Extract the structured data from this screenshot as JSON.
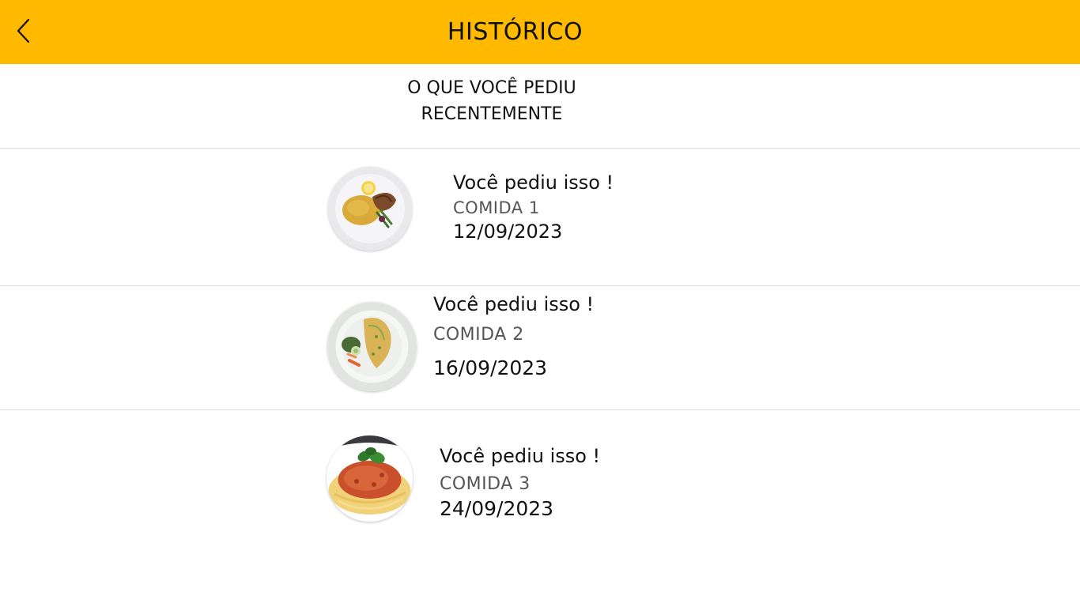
{
  "header": {
    "title": "HISTÓRICO",
    "back_icon": "chevron-left-icon",
    "background_color": "#FFBA00"
  },
  "subtitle": {
    "line1": "O QUE VOCÊ PEDIU",
    "line2": "RECENTEMENTE"
  },
  "orders": [
    {
      "heading": "Você pediu isso !",
      "name": "COMIDA 1",
      "date": "12/09/2023",
      "image": "plate-fish-rice-lemon"
    },
    {
      "heading": "Você pediu isso !",
      "name": "COMIDA 2",
      "date": "16/09/2023",
      "image": "plate-omelette-salad"
    },
    {
      "heading": "Você pediu isso !",
      "name": "COMIDA 3",
      "date": "24/09/2023",
      "image": "plate-spaghetti-bolognese"
    }
  ]
}
